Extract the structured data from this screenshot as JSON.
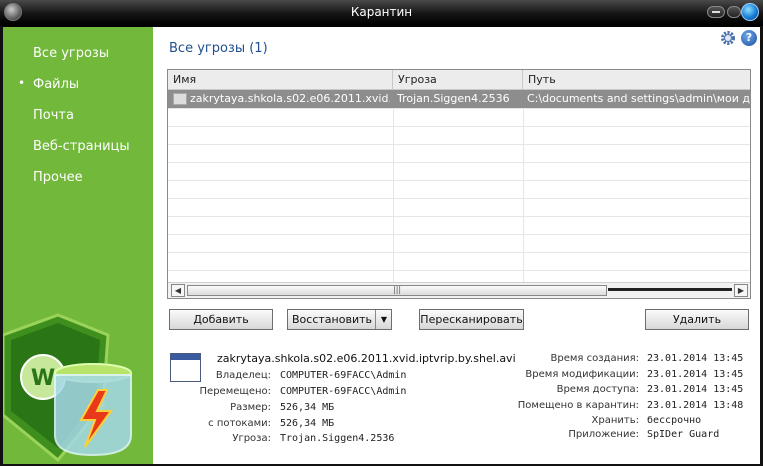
{
  "window": {
    "title": "Карантин"
  },
  "sidebar": {
    "items": [
      {
        "label": "Все угрозы",
        "active": true
      },
      {
        "label": "Файлы"
      },
      {
        "label": "Почта"
      },
      {
        "label": "Веб-страницы"
      },
      {
        "label": "Прочее"
      }
    ]
  },
  "main": {
    "heading": "Все угрозы (1)",
    "help_label": "?"
  },
  "table": {
    "columns": [
      "Имя",
      "Угроза",
      "Путь"
    ],
    "rows": [
      {
        "name": "zakrytaya.shkola.s02.e06.2011.xvid.i...",
        "threat": "Trojan.Siggen4.2536",
        "path": "C:\\documents and settings\\admin\\мои докуме"
      }
    ]
  },
  "buttons": {
    "add": "Добавить",
    "restore": "Восстановить",
    "rescan": "Пересканировать",
    "delete": "Удалить"
  },
  "details": {
    "file_name": "zakrytaya.shkola.s02.e06.2011.xvid.iptvrip.by.shel.avi",
    "left": [
      {
        "label": "Владелец:",
        "value": "COMPUTER-69FACC\\Admin"
      },
      {
        "label": "Перемещено:",
        "value": "COMPUTER-69FACC\\Admin"
      },
      {
        "label": "Размер:",
        "value": "526,34 МБ"
      },
      {
        "label": "с потоками:",
        "value": "526,34 МБ"
      },
      {
        "label": "Угроза:",
        "value": "Trojan.Siggen4.2536"
      }
    ],
    "right": [
      {
        "label": "Время создания:",
        "value": "23.01.2014 13:45"
      },
      {
        "label": "Время модификации:",
        "value": "23.01.2014 13:45"
      },
      {
        "label": "Время доступа:",
        "value": "23.01.2014 13:45"
      },
      {
        "label": "Помещено в карантин:",
        "value": "23.01.2014 13:48"
      },
      {
        "label": "Хранить:",
        "value": "бессрочно"
      },
      {
        "label": "Приложение:",
        "value": "SpIDer Guard"
      }
    ]
  },
  "icons": {
    "app": "drweb-app-icon",
    "minimize": "minimize-icon",
    "maximize": "maximize-icon",
    "close": "close-icon",
    "settings": "gear-icon",
    "help": "help-icon",
    "logo": "drweb-spider-logo"
  },
  "colors": {
    "sidebar": "#72b83a",
    "heading": "#1f4f8f",
    "selected_row": "#8d8d8d"
  }
}
